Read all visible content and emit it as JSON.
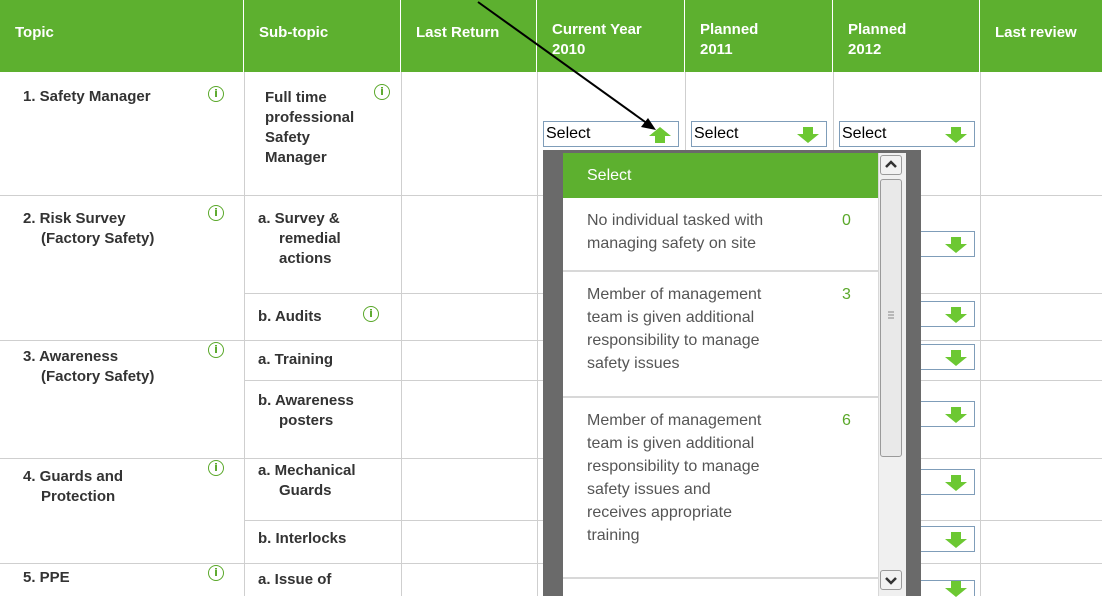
{
  "headers": [
    "Topic",
    "Sub-topic",
    "Last Return",
    "Current Year 2010",
    "Planned 2011",
    "Planned 2012",
    "Last review"
  ],
  "header_lines": {
    "current": [
      "Current Year",
      "2010"
    ],
    "p2011": [
      "Planned",
      "2011"
    ],
    "p2012": [
      "Planned",
      "2012"
    ]
  },
  "topics": [
    {
      "label": "1. Safety Manager",
      "lines": [
        "1. Safety Manager"
      ]
    },
    {
      "label": "2. Risk Survey (Factory Safety)",
      "lines": [
        "2. Risk Survey",
        "(Factory Safety)"
      ]
    },
    {
      "label": "3. Awareness (Factory Safety)",
      "lines": [
        "3. Awareness",
        "(Factory Safety)"
      ]
    },
    {
      "label": "4. Guards and Protection",
      "lines": [
        "4. Guards and",
        "Protection"
      ]
    },
    {
      "label": "5. PPE",
      "lines": [
        "5. PPE"
      ]
    }
  ],
  "subtopics": [
    {
      "lines": [
        "Full time",
        "professional",
        "Safety",
        "Manager"
      ]
    },
    {
      "lines": [
        "a. Survey &",
        "remedial",
        "actions"
      ]
    },
    {
      "lines": [
        "b. Audits"
      ]
    },
    {
      "lines": [
        "a. Training"
      ]
    },
    {
      "lines": [
        "b. Awareness",
        "posters"
      ]
    },
    {
      "lines": [
        "a. Mechanical",
        "Guards"
      ]
    },
    {
      "lines": [
        "b. Interlocks"
      ]
    },
    {
      "lines": [
        "a. Issue of"
      ]
    }
  ],
  "select_label": "Select",
  "info_glyph": "i",
  "dropdown": {
    "header": "Select",
    "options": [
      {
        "lines": [
          "No individual tasked with",
          "managing safety on site"
        ],
        "value": "0"
      },
      {
        "lines": [
          "Member of management",
          "team is given additional",
          "responsibility to manage",
          "safety issues"
        ],
        "value": "3"
      },
      {
        "lines": [
          "Member of management",
          "team is given additional",
          "responsibility to manage",
          "safety issues and",
          "receives appropriate",
          "training"
        ],
        "value": "6"
      }
    ]
  },
  "colors": {
    "accent": "#5db02f",
    "arrow": "#6cc832",
    "value": "#5aa82a"
  }
}
